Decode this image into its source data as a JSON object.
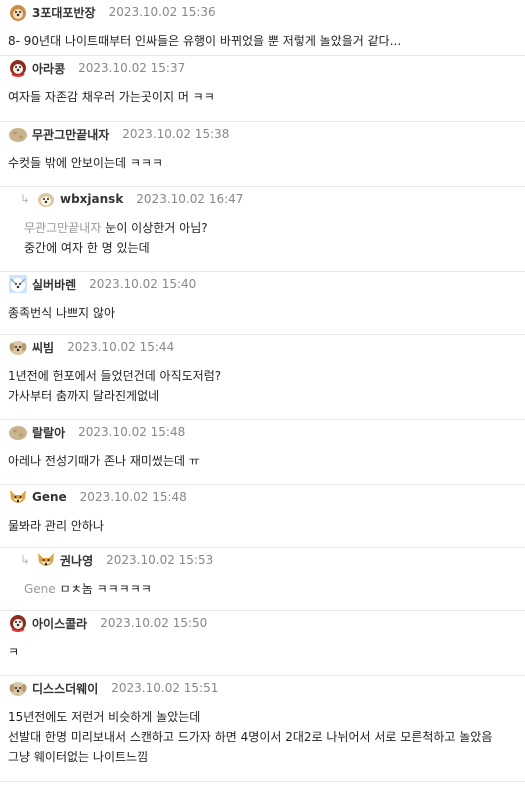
{
  "comments": [
    {
      "nick": "3포대포반장",
      "date": "2023.10.02 15:36",
      "avatar": "brown-dog",
      "lines": [
        "8- 90년대 나이트때부터 인싸들은 유행이 바뀌었을 뿐 저렇게 놀았을거 같다..."
      ]
    },
    {
      "nick": "아라콩",
      "date": "2023.10.02 15:37",
      "avatar": "red-dog",
      "lines": [
        "여자들 자존감 채우러 가는곳이지 머 ㅋㅋ"
      ]
    },
    {
      "nick": "무관그만끝내자",
      "date": "2023.10.02 15:38",
      "avatar": "potato",
      "lines": [
        "수컷들 밖에 안보이는데 ㅋㅋㅋ"
      ]
    },
    {
      "nick": "wbxjansk",
      "date": "2023.10.02 16:47",
      "avatar": "white-dog",
      "reply": true,
      "mention": "무관그만끝내자",
      "lines": [
        "눈이 이상한거 아님?",
        "중간에 여자 한 명 있는데"
      ]
    },
    {
      "nick": "실버바렌",
      "date": "2023.10.02 15:40",
      "avatar": "blue-dog",
      "lines": [
        "종족번식 나쁘지 않아"
      ]
    },
    {
      "nick": "씨빔",
      "date": "2023.10.02 15:44",
      "avatar": "puppy",
      "lines": [
        "1년전에 헌포에서 들었던건데 아직도저럼?",
        "가사부터 춤까지 달라진게없네"
      ]
    },
    {
      "nick": "랄랄아",
      "date": "2023.10.02 15:48",
      "avatar": "potato",
      "lines": [
        "아레나 전성기때가 존나 재미썼는데 ㅠ"
      ]
    },
    {
      "nick": "Gene",
      "date": "2023.10.02 15:48",
      "avatar": "fox",
      "lines": [
        "물봐라 관리 안하나"
      ]
    },
    {
      "nick": "권나영",
      "date": "2023.10.02 15:53",
      "avatar": "fox",
      "reply": true,
      "mention": "Gene",
      "lines": [
        "ㅁㅊ놈 ㅋㅋㅋㅋㅋ"
      ]
    },
    {
      "nick": "아이스콜라",
      "date": "2023.10.02 15:50",
      "avatar": "red-dog",
      "lines": [
        "ㅋ"
      ]
    },
    {
      "nick": "디스스더웨이",
      "date": "2023.10.02 15:51",
      "avatar": "puppy",
      "lines": [
        "15년전에도 저런거 비슷하게 놀았는데",
        "선발대 한명 미리보내서 스캔하고 드가자 하면 4명이서 2대2로 나뉘어서 서로 모른척하고 놀았음",
        "그냥 웨이터없는 나이트느낌"
      ]
    }
  ]
}
